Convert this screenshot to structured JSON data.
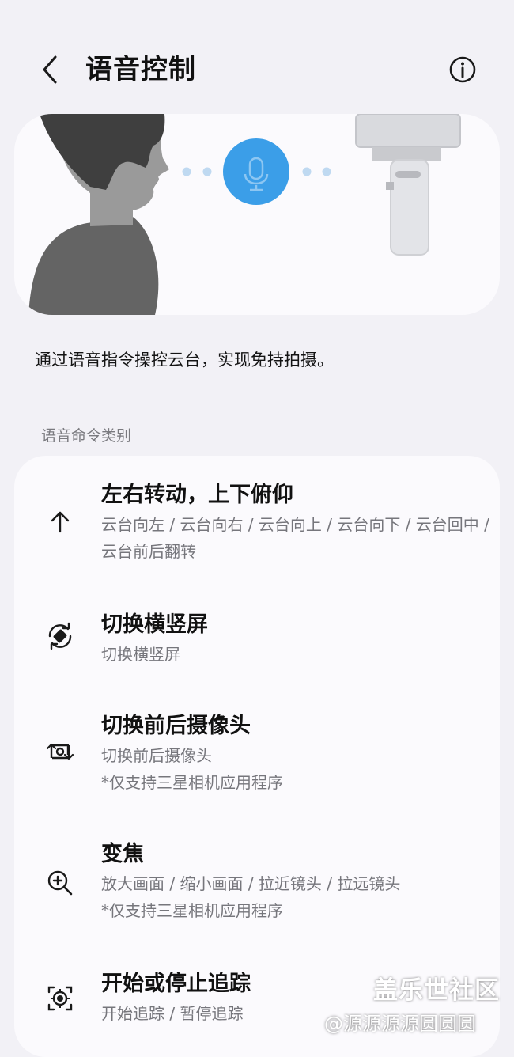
{
  "header": {
    "title": "语音控制",
    "back_icon": "chevron-left-icon",
    "info_icon": "info-icon"
  },
  "description": "通过语音指令操控云台，实现免持拍摄。",
  "section_label": "语音命令类别",
  "accent_color": "#3b9ee8",
  "commands": [
    {
      "icon": "arrow-up-icon",
      "title": "左右转动，上下俯仰",
      "subtitle": "云台向左 / 云台向右 / 云台向上 / 云台向下 / 云台回中 / 云台前后翻转"
    },
    {
      "icon": "rotate-screen-icon",
      "title": "切换横竖屏",
      "subtitle": "切换横竖屏"
    },
    {
      "icon": "switch-camera-icon",
      "title": "切换前后摄像头",
      "subtitle": "切换前后摄像头",
      "note": "*仅支持三星相机应用程序"
    },
    {
      "icon": "zoom-in-icon",
      "title": "变焦",
      "subtitle": "放大画面 / 缩小画面 / 拉近镜头 / 拉远镜头",
      "note": "*仅支持三星相机应用程序"
    },
    {
      "icon": "tracking-icon",
      "title": "开始或停止追踪",
      "subtitle": "开始追踪 / 暂停追踪"
    }
  ],
  "watermark": {
    "brand": "盖乐世社区",
    "user": "@源源源源圆圆圆"
  }
}
